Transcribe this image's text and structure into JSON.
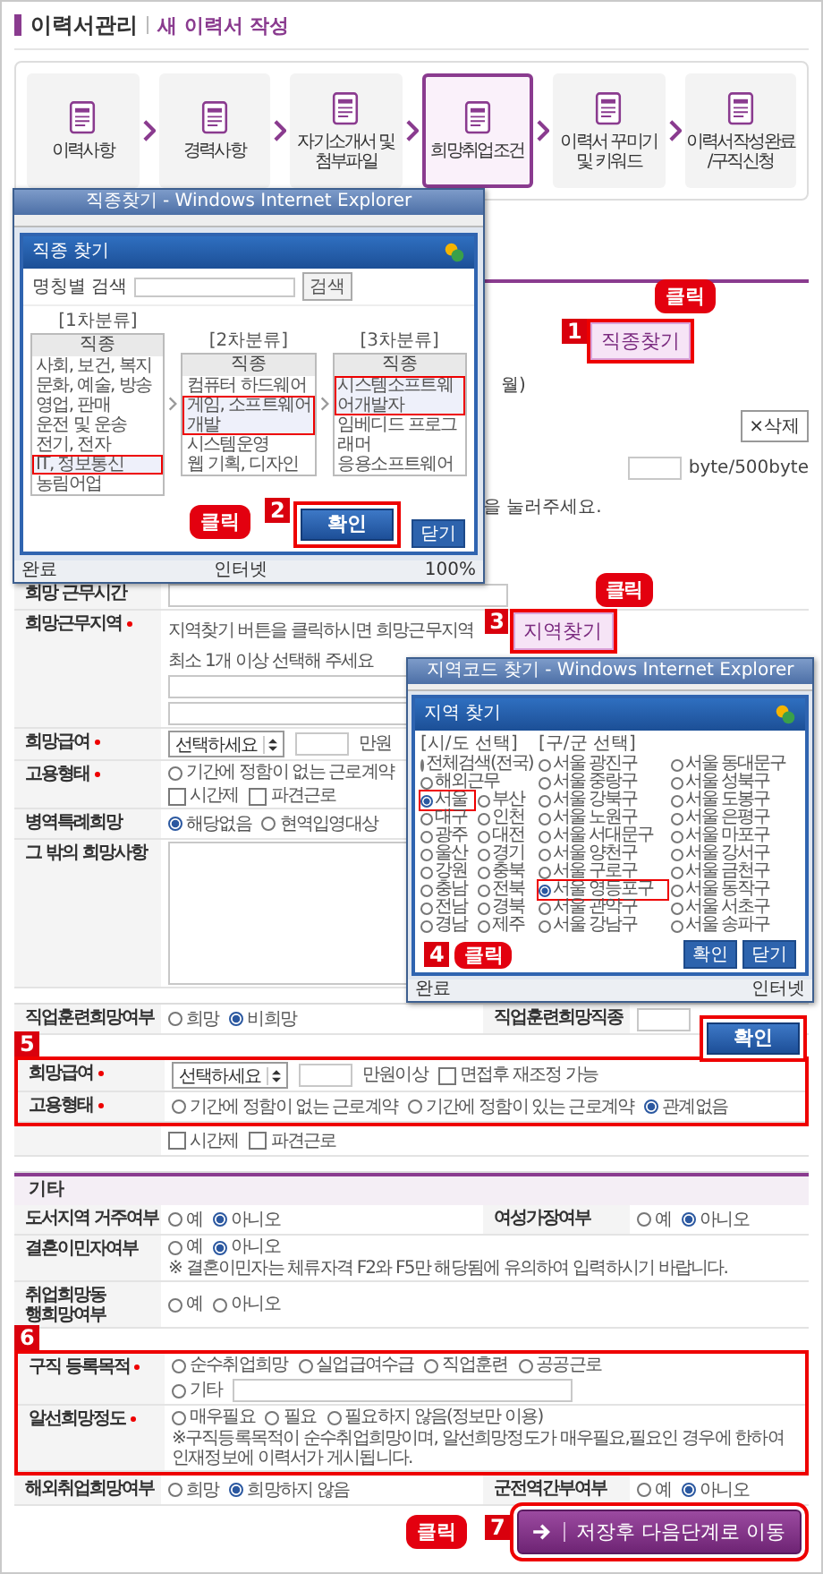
{
  "header": {
    "title": "이력서관리",
    "subtitle": "새 이력서 작성"
  },
  "steps": [
    {
      "label": "이력사항",
      "selected": false
    },
    {
      "label": "경력사항",
      "selected": false
    },
    {
      "label": "자기소개서 및\n첨부파일",
      "selected": false
    },
    {
      "label": "희망취업조건",
      "selected": true
    },
    {
      "label": "이력서 꾸미기\n및 키워드",
      "selected": false
    },
    {
      "label": "이력서작성완료\n/구직신청",
      "selected": false
    }
  ],
  "job_fragments": {
    "search_button": "직종찾기",
    "step": "1",
    "click": "클릭",
    "month_tail": "월)",
    "delete_button": "×삭제",
    "byte_counter": "byte/500byte",
    "hint_tail": "을 눌러주세요."
  },
  "groups": [
    {
      "kind": "rows",
      "rows": [
        {
          "cells": [
            {
              "label": "희망 근무시간",
              "required": false,
              "controls": [
                {
                  "kind": "longfield"
                }
              ]
            }
          ]
        },
        {
          "cells": [
            {
              "label": "희망근무지역",
              "required": true,
              "controls": [
                {
                  "kind": "text",
                  "text": "지역찾기 버튼을 클릭하시면 희망근무지역"
                },
                {
                  "kind": "search",
                  "label": "지역찾기",
                  "step": "3",
                  "click": "클릭"
                },
                {
                  "kind": "text",
                  "text": "최소 1개 이상 선택해 주세요"
                },
                {
                  "kind": "break"
                },
                {
                  "kind": "longfield"
                },
                {
                  "kind": "break"
                },
                {
                  "kind": "longfield"
                }
              ]
            }
          ]
        },
        {
          "cells": [
            {
              "label": "희망급여",
              "required": true,
              "controls": [
                {
                  "kind": "select",
                  "value": "선택하세요"
                },
                {
                  "kind": "field"
                },
                {
                  "kind": "text",
                  "text": "만원"
                }
              ]
            }
          ]
        },
        {
          "cells": [
            {
              "label": "고용형태",
              "required": true,
              "controls": [
                {
                  "kind": "radio",
                  "label": "기간에 정함이 없는 근로계약",
                  "selected": false
                },
                {
                  "kind": "break"
                },
                {
                  "kind": "checkbox",
                  "label": "시간제",
                  "checked": false
                },
                {
                  "kind": "checkbox",
                  "label": "파견근로",
                  "checked": false
                }
              ]
            }
          ]
        },
        {
          "cells": [
            {
              "label": "병역특례희망",
              "required": false,
              "controls": [
                {
                  "kind": "radio",
                  "label": "해당없음",
                  "selected": true
                },
                {
                  "kind": "radio",
                  "label": "현역입영대상",
                  "selected": false
                }
              ]
            }
          ]
        },
        {
          "cells": [
            {
              "label": "그 밖의 희망사항",
              "required": false,
              "controls": [
                {
                  "kind": "textarea"
                }
              ]
            }
          ]
        }
      ]
    },
    {
      "kind": "table",
      "rows": [
        {
          "cells": [
            {
              "label": "직업훈련희망여부",
              "required": false,
              "controls": [
                {
                  "kind": "radio",
                  "label": "희망",
                  "selected": false
                },
                {
                  "kind": "radio",
                  "label": "비희망",
                  "selected": true
                }
              ]
            },
            {
              "label": "직업훈련희망직종",
              "required": false,
              "controls": [
                {
                  "kind": "field"
                }
              ]
            }
          ]
        }
      ]
    },
    {
      "kind": "box",
      "step": "5",
      "rows": [
        {
          "cells": [
            {
              "label": "희망급여",
              "required": true,
              "controls": [
                {
                  "kind": "select",
                  "value": "선택하세요"
                },
                {
                  "kind": "field"
                },
                {
                  "kind": "text",
                  "text": "만원이상"
                },
                {
                  "kind": "checkbox",
                  "label": "면접후 재조정 가능",
                  "checked": false
                }
              ]
            }
          ]
        },
        {
          "cells": [
            {
              "label": "고용형태",
              "required": true,
              "controls": [
                {
                  "kind": "radio",
                  "label": "기간에 정함이 없는 근로계약",
                  "selected": false
                },
                {
                  "kind": "radio",
                  "label": "기간에 정함이 있는 근로계약",
                  "selected": false
                },
                {
                  "kind": "radio",
                  "label": "관계없음",
                  "selected": true
                }
              ]
            }
          ]
        }
      ]
    },
    {
      "kind": "rows",
      "rows": [
        {
          "cells": [
            {
              "controls": [
                {
                  "kind": "checkbox",
                  "label": "시간제",
                  "checked": false
                },
                {
                  "kind": "checkbox",
                  "label": "파견근로",
                  "checked": false
                }
              ]
            }
          ]
        }
      ]
    },
    {
      "kind": "table",
      "title": "기타",
      "rows": [
        {
          "cells": [
            {
              "label": "도서지역 거주여부",
              "required": false,
              "controls": [
                {
                  "kind": "radio",
                  "label": "예",
                  "selected": false
                },
                {
                  "kind": "radio",
                  "label": "아니오",
                  "selected": true
                }
              ]
            },
            {
              "label": "여성가장여부",
              "required": false,
              "controls": [
                {
                  "kind": "radio",
                  "label": "예",
                  "selected": false
                },
                {
                  "kind": "radio",
                  "label": "아니오",
                  "selected": true
                }
              ]
            }
          ]
        },
        {
          "cells": [
            {
              "label": "결혼이민자여부",
              "required": false,
              "controls": [
                {
                  "kind": "radio",
                  "label": "예",
                  "selected": false
                },
                {
                  "kind": "radio",
                  "label": "아니오",
                  "selected": true
                },
                {
                  "kind": "text",
                  "text": "※ 결혼이민자는 체류자격 F2와 F5만 해당됨에 유의하여 입력하시기 바랍니다."
                }
              ]
            }
          ]
        },
        {
          "cells": [
            {
              "label": "취업희망동\n행희망여부",
              "required": false,
              "controls": [
                {
                  "kind": "radio",
                  "label": "예",
                  "selected": false
                },
                {
                  "kind": "radio",
                  "label": "아니오",
                  "selected": false
                }
              ]
            }
          ]
        }
      ]
    },
    {
      "kind": "box",
      "step": "6",
      "rows": [
        {
          "cells": [
            {
              "label": "구직 등록목적",
              "required": true,
              "controls": [
                {
                  "kind": "radio",
                  "label": "순수취업희망",
                  "selected": false
                },
                {
                  "kind": "radio",
                  "label": "실업급여수급",
                  "selected": false
                },
                {
                  "kind": "radio",
                  "label": "직업훈련",
                  "selected": false
                },
                {
                  "kind": "radio",
                  "label": "공공근로",
                  "selected": false
                },
                {
                  "kind": "break"
                },
                {
                  "kind": "radio",
                  "label": "기타",
                  "selected": false
                },
                {
                  "kind": "longfield"
                }
              ]
            }
          ]
        },
        {
          "cells": [
            {
              "label": "알선희망정도",
              "required": true,
              "controls": [
                {
                  "kind": "radio",
                  "label": "매우필요",
                  "selected": false
                },
                {
                  "kind": "radio",
                  "label": "필요",
                  "selected": false
                },
                {
                  "kind": "radio",
                  "label": "필요하지 않음(정보만 이용)",
                  "selected": false
                },
                {
                  "kind": "text",
                  "text": "※구직등록목적이 순수취업희망이며, 알선희망정도가 매우필요,필요인 경우에 한하여 인재정보에 이력서가 게시됩니다."
                }
              ]
            }
          ]
        }
      ]
    },
    {
      "kind": "rows",
      "rows": [
        {
          "cells": [
            {
              "label": "해외취업희망여부",
              "required": false,
              "controls": [
                {
                  "kind": "radio",
                  "label": "희망",
                  "selected": false
                },
                {
                  "kind": "radio",
                  "label": "희망하지 않음",
                  "selected": true
                }
              ]
            },
            {
              "label": "군전역간부여부",
              "required": false,
              "controls": [
                {
                  "kind": "radio",
                  "label": "예",
                  "selected": false
                },
                {
                  "kind": "radio",
                  "label": "아니오",
                  "selected": true
                }
              ]
            }
          ]
        }
      ]
    }
  ],
  "next_button": {
    "label": "저장후 다음단계로 이동",
    "step": "7",
    "click": "클릭"
  },
  "job_popup": {
    "title": "직종찾기 - Windows Internet Explorer",
    "heading": "직종 찾기",
    "search_label": "명칭별 검색",
    "search_button": "검색",
    "columns": [
      {
        "caption": "[1차분류]",
        "header": "직종",
        "items": [
          {
            "label": "사회, 보건, 복지",
            "selected": false
          },
          {
            "label": "문화, 예술, 방송",
            "selected": false
          },
          {
            "label": "영업, 판매",
            "selected": false
          },
          {
            "label": "운전 및 운송",
            "selected": false
          },
          {
            "label": "전기, 전자",
            "selected": false
          },
          {
            "label": "IT, 정보통신",
            "selected": true
          },
          {
            "label": "농림어업",
            "selected": false
          }
        ]
      },
      {
        "caption": "[2차분류]",
        "header": "직종",
        "items": [
          {
            "label": "컴퓨터 하드웨어",
            "selected": false
          },
          {
            "label": "게임, 소프트웨어 개발",
            "selected": true
          },
          {
            "label": "시스템운영",
            "selected": false
          },
          {
            "label": "웹 기획, 디자인",
            "selected": false
          }
        ]
      },
      {
        "caption": "[3차분류]",
        "header": "직종",
        "items": [
          {
            "label": "시스템소프트웨어개발자",
            "selected": true
          },
          {
            "label": "임베디드 프로그래머",
            "selected": false
          },
          {
            "label": "응용소프트웨어",
            "selected": false
          }
        ]
      }
    ],
    "confirm": {
      "label": "확인",
      "step": "2",
      "click": "클릭"
    },
    "close": "닫기",
    "status": "완료",
    "zone": "인터넷",
    "zoom": "100%"
  },
  "region_popup": {
    "title": "지역코드 찾기 - Windows Internet Explorer",
    "heading": "지역 찾기",
    "left_caption": "[시/도 선택]",
    "right_caption": "[구/군 선택]",
    "regions": [
      {
        "label": "전체검색(전국)",
        "selected": false
      },
      {
        "label": "해외근무",
        "selected": false
      },
      {
        "label": "서울",
        "selected": true
      },
      {
        "label": "부산",
        "selected": false
      },
      {
        "label": "대구",
        "selected": false
      },
      {
        "label": "인천",
        "selected": false
      },
      {
        "label": "광주",
        "selected": false
      },
      {
        "label": "대전",
        "selected": false
      },
      {
        "label": "울산",
        "selected": false
      },
      {
        "label": "경기",
        "selected": false
      },
      {
        "label": "강원",
        "selected": false
      },
      {
        "label": "충북",
        "selected": false
      },
      {
        "label": "충남",
        "selected": false
      },
      {
        "label": "전북",
        "selected": false
      },
      {
        "label": "전남",
        "selected": false
      },
      {
        "label": "경북",
        "selected": false
      },
      {
        "label": "경남",
        "selected": false
      },
      {
        "label": "제주",
        "selected": false
      }
    ],
    "districts": [
      {
        "label": "서울 광진구",
        "selected": false
      },
      {
        "label": "서울 동대문구",
        "selected": false
      },
      {
        "label": "서울 중랑구",
        "selected": false
      },
      {
        "label": "서울 성북구",
        "selected": false
      },
      {
        "label": "서울 강북구",
        "selected": false
      },
      {
        "label": "서울 도봉구",
        "selected": false
      },
      {
        "label": "서울 노원구",
        "selected": false
      },
      {
        "label": "서울 은평구",
        "selected": false
      },
      {
        "label": "서울 서대문구",
        "selected": false
      },
      {
        "label": "서울 마포구",
        "selected": false
      },
      {
        "label": "서울 양천구",
        "selected": false
      },
      {
        "label": "서울 강서구",
        "selected": false
      },
      {
        "label": "서울 구로구",
        "selected": false
      },
      {
        "label": "서울 금천구",
        "selected": false
      },
      {
        "label": "서울 영등포구",
        "selected": true
      },
      {
        "label": "서울 동작구",
        "selected": false
      },
      {
        "label": "서울 관악구",
        "selected": false
      },
      {
        "label": "서울 서초구",
        "selected": false
      },
      {
        "label": "서울 강남구",
        "selected": false
      },
      {
        "label": "서울 송파구",
        "selected": false
      }
    ],
    "buttons": [
      "확인",
      "닫기"
    ],
    "step": "4",
    "click": "클릭",
    "status": "완료",
    "zone": "인터넷"
  },
  "region_confirm": {
    "label": "확인"
  }
}
